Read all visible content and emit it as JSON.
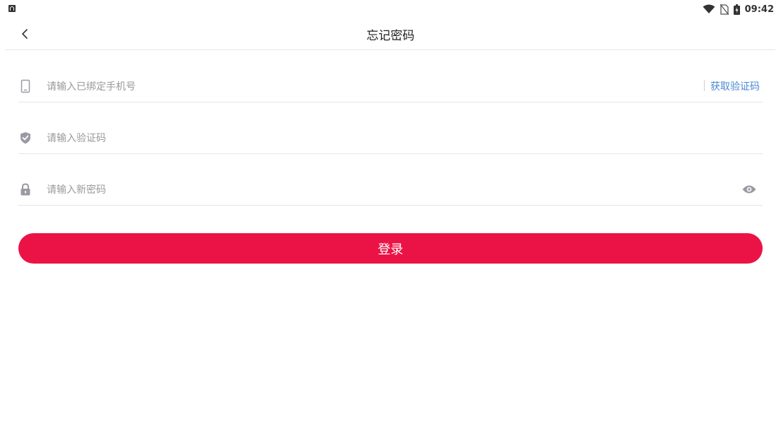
{
  "status_bar": {
    "app_icon": "android-app-icon",
    "icons": [
      "wifi-icon",
      "no-sim-icon",
      "battery-icon"
    ],
    "time": "09:42"
  },
  "header": {
    "back_icon": "back-arrow-icon",
    "title": "忘记密码"
  },
  "form": {
    "phone": {
      "icon": "phone-icon",
      "placeholder": "请输入已绑定手机号",
      "value": ""
    },
    "get_code_label": "获取验证码",
    "code": {
      "icon": "shield-check-icon",
      "placeholder": "请输入验证码",
      "value": ""
    },
    "password": {
      "icon": "lock-icon",
      "placeholder": "请输入新密码",
      "value": "",
      "toggle_icon": "eye-icon"
    },
    "submit_label": "登录"
  },
  "colors": {
    "primary": "#eb1346",
    "link": "#4a88d6",
    "icon_gray": "#9a9aa4",
    "divider": "#e6e6e6"
  }
}
